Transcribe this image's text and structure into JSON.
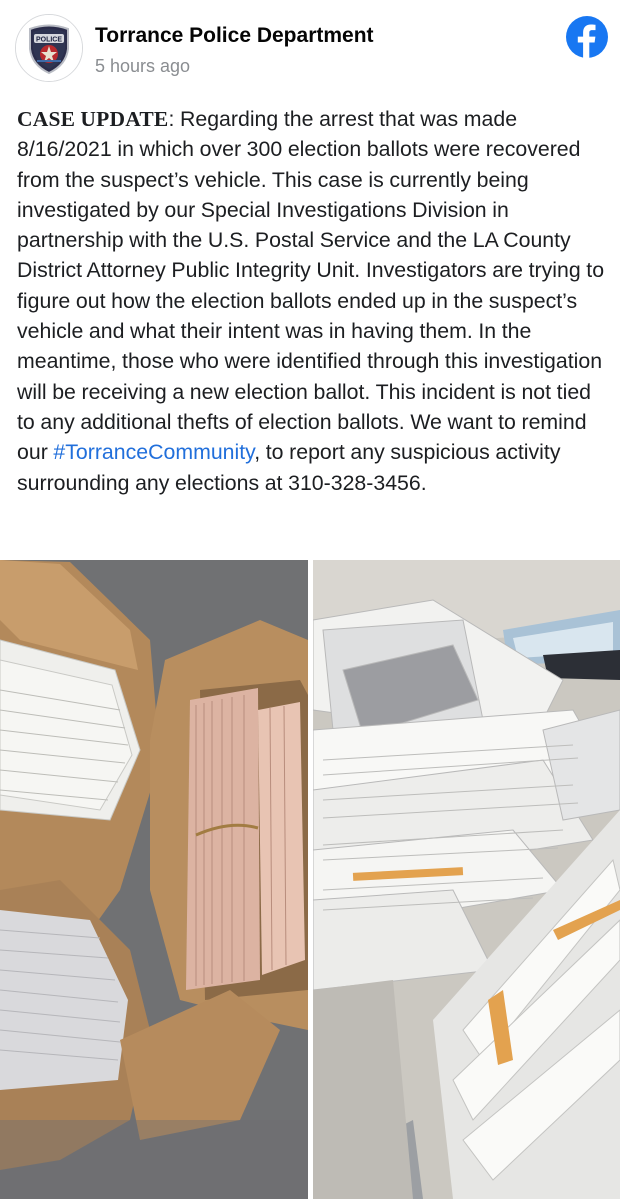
{
  "header": {
    "page_name": "Torrance Police Department",
    "timestamp": "5 hours ago",
    "avatar_icon": "police-badge-icon",
    "badge_text": "POLICE",
    "network_icon": "facebook-icon"
  },
  "post": {
    "lead": "CASE UPDATE",
    "lead_sep": ":",
    "body_1": " Regarding the arrest that was made 8/16/2021 in which over 300 election ballots were recovered from the suspect’s vehicle. This case is currently being investigated by our Special Investigations Division in partnership with the U.S. Postal Service and the LA County District Attorney Public Integrity Unit. Investigators are trying to figure out how the election ballots ended up in the suspect’s vehicle and what their intent was in having them. In the meantime, those who were identified through this investigation will be receiving a new election ballot. This incident is not tied to any additional thefts of election ballots. We want to remind our ",
    "hashtag": "#TorranceCommunity",
    "body_2": ", to report any suspicious activity surrounding any elections at 310-328-3456."
  },
  "photos": [
    {
      "name": "paper-bags-of-ballots-photo"
    },
    {
      "name": "scattered-ballots-on-floor-photo"
    }
  ],
  "colors": {
    "link": "#216fdb",
    "facebook_blue": "#1877f2",
    "timestamp_gray": "#8a8d91"
  }
}
